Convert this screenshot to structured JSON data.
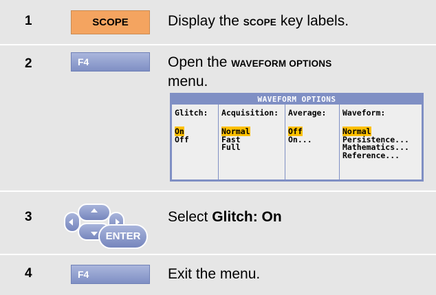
{
  "steps": [
    {
      "number": "1",
      "key": "SCOPE",
      "text_before": "Display the ",
      "text_bold": "SCOPE",
      "text_after": " key labels."
    },
    {
      "number": "2",
      "key": "F4",
      "text_before": "Open the ",
      "text_bold": "WAVEFORM OPTIONS",
      "text_after": "menu."
    },
    {
      "number": "3",
      "key": "ENTER",
      "text_before": "Select ",
      "text_bold": "Glitch: On",
      "text_after": ""
    },
    {
      "number": "4",
      "key": "F4",
      "text_before": "Exit the menu.",
      "text_bold": "",
      "text_after": ""
    }
  ],
  "menu": {
    "title": "WAVEFORM OPTIONS",
    "columns": [
      {
        "header": "Glitch:",
        "options": [
          "On",
          "Off"
        ],
        "selected": "On"
      },
      {
        "header": "Acquisition:",
        "options": [
          "Normal",
          "Fast",
          "Full"
        ],
        "selected": "Normal"
      },
      {
        "header": "Average:",
        "options": [
          "Off",
          "On..."
        ],
        "selected": "Off"
      },
      {
        "header": "Waveform:",
        "options": [
          "Normal",
          "Persistence...",
          "Mathematics...",
          "Reference..."
        ],
        "selected": "Normal"
      }
    ]
  },
  "colors": {
    "scope_key": "#f4a460",
    "function_key": "#7f8fc4",
    "row_background": "#e6e6e6",
    "selection_highlight": "#ffc000"
  },
  "icons": {
    "arrow_pad": "arrow-keys-enter-icon"
  }
}
